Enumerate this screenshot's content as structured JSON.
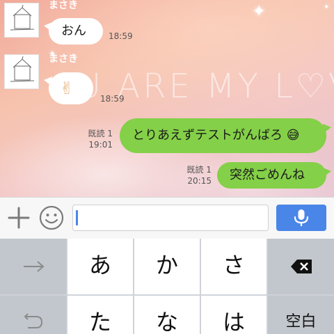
{
  "messages": [
    {
      "sender": "まさき",
      "text": "おん",
      "time": "18:59"
    },
    {
      "sender": "まさき",
      "text": "✌",
      "time": "18:59"
    },
    {
      "read": "既読 1",
      "time": "19:01",
      "text": "とりあえずテストがんばろ",
      "emoji": "😅"
    },
    {
      "read": "既読 1",
      "time": "20:15",
      "text": "突然ごめんね"
    }
  ],
  "wallpaper": {
    "caption": "U ARE MY L♡VE"
  },
  "input": {
    "value": "",
    "placeholder": ""
  },
  "icons": {
    "plus": "plus-icon",
    "emoji": "smiley-icon",
    "mic": "microphone-icon",
    "next": "arrow-right-icon",
    "undo": "undo-icon",
    "delete": "backspace-icon"
  },
  "keyboard": {
    "row1": [
      "あ",
      "か",
      "さ"
    ],
    "row2": [
      "た",
      "な",
      "は"
    ],
    "space_label": "空白"
  },
  "colors": {
    "outgoing_bubble": "#84d048",
    "incoming_bubble": "#ffffff",
    "mic_button": "#4a86e8",
    "caret": "#4a86e8"
  }
}
